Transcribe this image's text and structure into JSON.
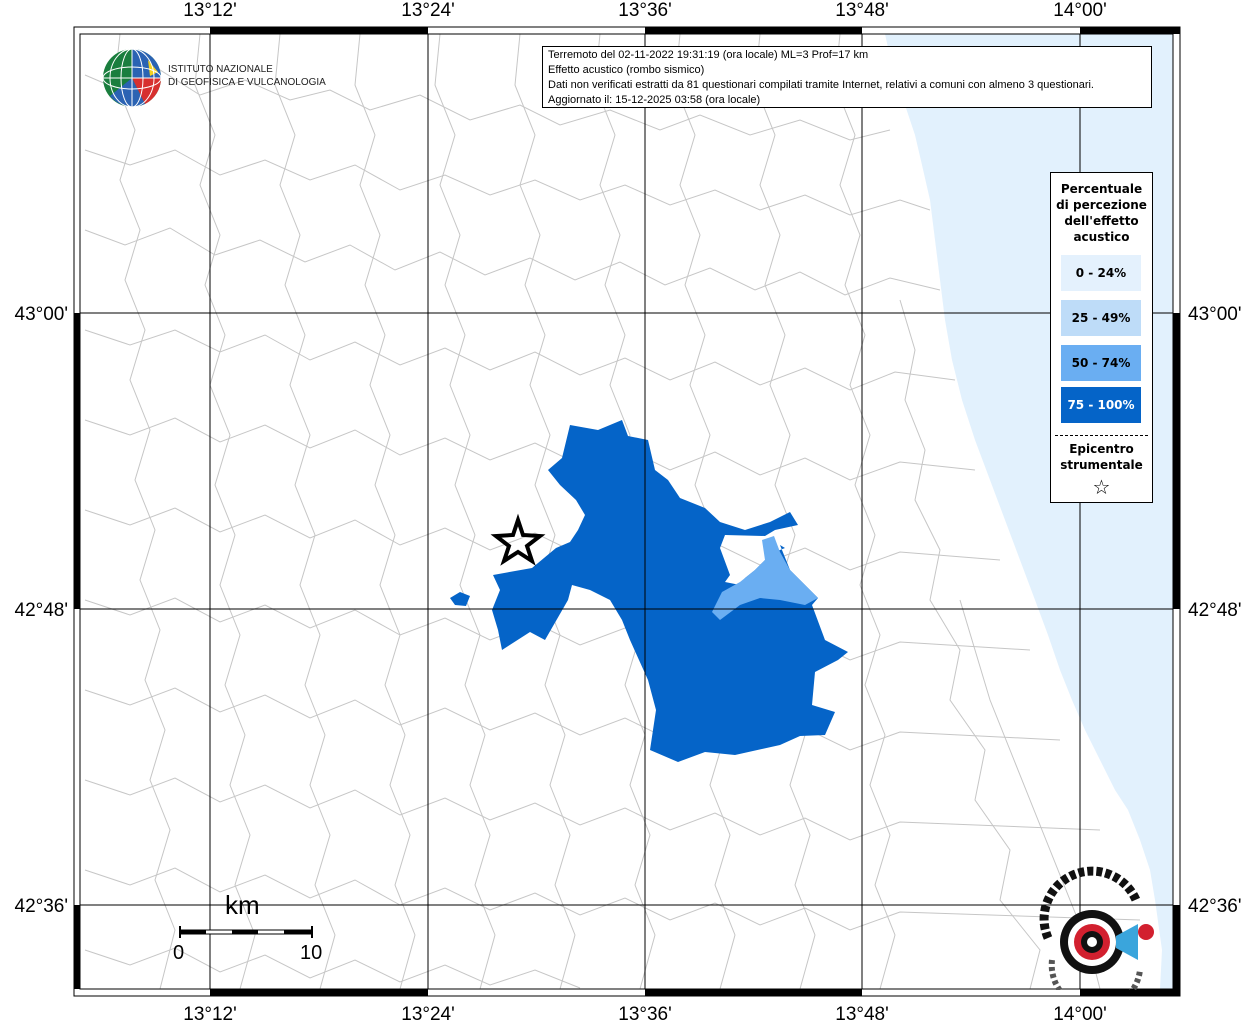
{
  "info": {
    "line1": "Terremoto del 02-11-2022 19:31:19 (ora locale) ML=3 Prof=17 km",
    "line2": "Effetto acustico (rombo sismico)",
    "line3": "Dati non verificati estratti da 81 questionari compilati tramite Internet, relativi a comuni con almeno 3 questionari.",
    "line4": "Aggiornato il: 15-12-2025 03:58 (ora locale)"
  },
  "logo": {
    "line1": "ISTITUTO NAZIONALE",
    "line2": "DI GEOFISICA E VULCANOLOGIA"
  },
  "axes": {
    "lon_labels": [
      "13°12'",
      "13°24'",
      "13°36'",
      "13°48'",
      "14°00'"
    ],
    "lat_labels": [
      "43°00'",
      "42°48'",
      "42°36'"
    ]
  },
  "legend": {
    "title_lines": [
      "Percentuale",
      "di percezione",
      "dell'effetto",
      "acustico"
    ],
    "classes": [
      {
        "label": "0 - 24%",
        "color": "#e4f1fd"
      },
      {
        "label": "25 - 49%",
        "color": "#bedcf8"
      },
      {
        "label": "50 - 74%",
        "color": "#6aaef2"
      },
      {
        "label": "75 - 100%",
        "color": "#0564c8"
      }
    ],
    "epicenter_lines": [
      "Epicentro",
      "strumentale"
    ],
    "star_glyph": "☆"
  },
  "scale": {
    "unit": "km",
    "min": "0",
    "max": "10"
  },
  "colors": {
    "sea": "#e2f1fd",
    "high": "#0564c8",
    "mid": "#6aaef2",
    "boundary": "#c4c4c4"
  }
}
